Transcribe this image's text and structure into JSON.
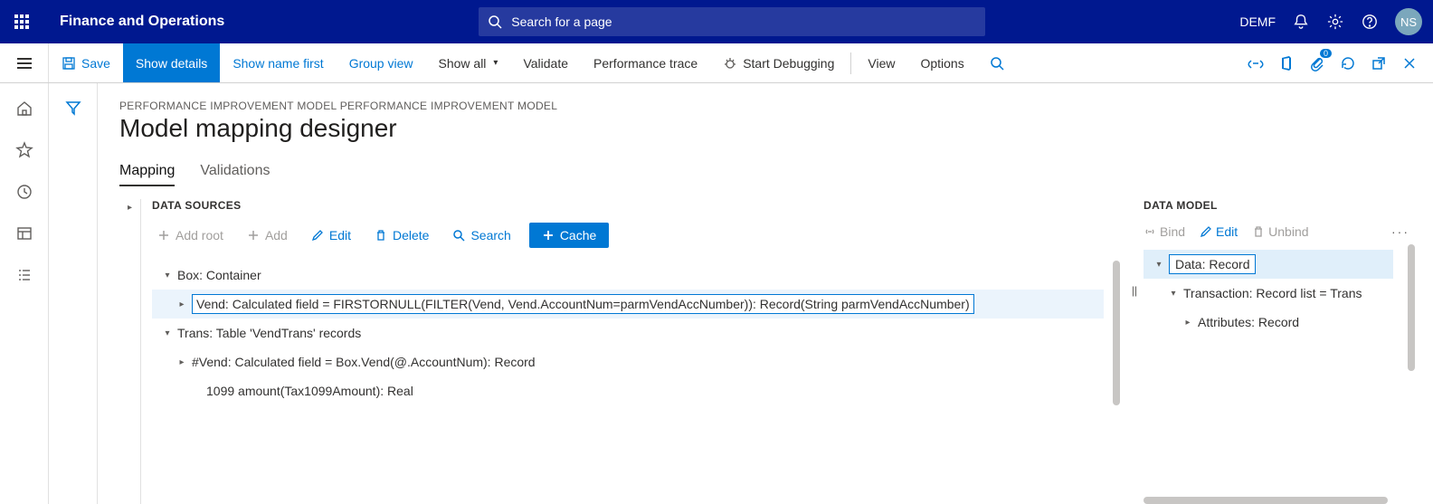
{
  "header": {
    "app_title": "Finance and Operations",
    "search_placeholder": "Search for a page",
    "company": "DEMF",
    "user_initials": "NS"
  },
  "commandbar": {
    "save": "Save",
    "show_details": "Show details",
    "show_name_first": "Show name first",
    "group_view": "Group view",
    "show_all": "Show all",
    "validate": "Validate",
    "performance_trace": "Performance trace",
    "start_debugging": "Start Debugging",
    "view": "View",
    "options": "Options",
    "badge": "0"
  },
  "page": {
    "breadcrumb": "PERFORMANCE IMPROVEMENT MODEL PERFORMANCE IMPROVEMENT MODEL",
    "title": "Model mapping designer",
    "tabs": {
      "mapping": "Mapping",
      "validations": "Validations"
    }
  },
  "datasources": {
    "heading": "DATA SOURCES",
    "buttons": {
      "add_root": "Add root",
      "add": "Add",
      "edit": "Edit",
      "delete": "Delete",
      "search": "Search",
      "cache": "Cache"
    },
    "tree": [
      {
        "label": "Box: Container",
        "indent": 0,
        "caret": "▾",
        "selected": false
      },
      {
        "label": "Vend: Calculated field = FIRSTORNULL(FILTER(Vend, Vend.AccountNum=parmVendAccNumber)): Record(String parmVendAccNumber)",
        "indent": 1,
        "caret": "▸",
        "selected": true
      },
      {
        "label": "Trans: Table 'VendTrans' records",
        "indent": 0,
        "caret": "▾",
        "selected": false
      },
      {
        "label": "#Vend: Calculated field = Box.Vend(@.AccountNum): Record",
        "indent": 1,
        "caret": "▸",
        "selected": false
      },
      {
        "label": "1099 amount(Tax1099Amount): Real",
        "indent": 1,
        "caret": "",
        "selected": false
      }
    ]
  },
  "datamodel": {
    "heading": "DATA MODEL",
    "buttons": {
      "bind": "Bind",
      "edit": "Edit",
      "unbind": "Unbind"
    },
    "tree": [
      {
        "label": "Data: Record",
        "indent": 0,
        "caret": "▾",
        "selected": true
      },
      {
        "label": "Transaction: Record list = Trans",
        "indent": 1,
        "caret": "▾",
        "selected": false
      },
      {
        "label": "Attributes: Record",
        "indent": 2,
        "caret": "▸",
        "selected": false
      }
    ]
  }
}
